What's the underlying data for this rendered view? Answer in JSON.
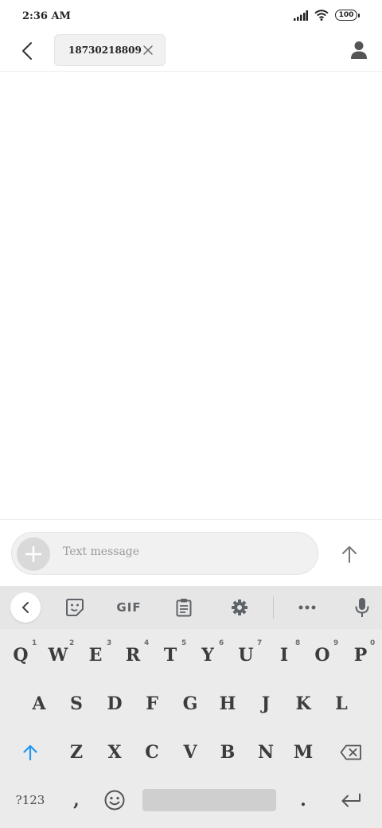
{
  "status_bar": {
    "time": "2:36 AM",
    "battery": "100",
    "icons": [
      "signal-icon",
      "wifi-icon",
      "battery-icon"
    ]
  },
  "header": {
    "recipient": "18730218809",
    "icons": [
      "back-arrow-icon",
      "close-icon",
      "person-icon"
    ]
  },
  "compose": {
    "placeholder": "Text message",
    "icons": [
      "plus-icon",
      "send-arrow-icon"
    ]
  },
  "keyboard": {
    "toolbar": {
      "gif_label": "GIF",
      "icons": [
        "chevron-left-icon",
        "sticker-icon",
        "clipboard-icon",
        "gear-icon",
        "more-icon",
        "microphone-icon"
      ]
    },
    "row1": [
      "Q",
      "W",
      "E",
      "R",
      "T",
      "Y",
      "U",
      "I",
      "O",
      "P"
    ],
    "row1_hints": [
      "1",
      "2",
      "3",
      "4",
      "5",
      "6",
      "7",
      "8",
      "9",
      "0"
    ],
    "row2": [
      "A",
      "S",
      "D",
      "F",
      "G",
      "H",
      "J",
      "K",
      "L"
    ],
    "row3": [
      "Z",
      "X",
      "C",
      "V",
      "B",
      "N",
      "M"
    ],
    "symbols_label": "?123",
    "comma": ",",
    "period": ".",
    "accent_color": "#2196f3"
  }
}
